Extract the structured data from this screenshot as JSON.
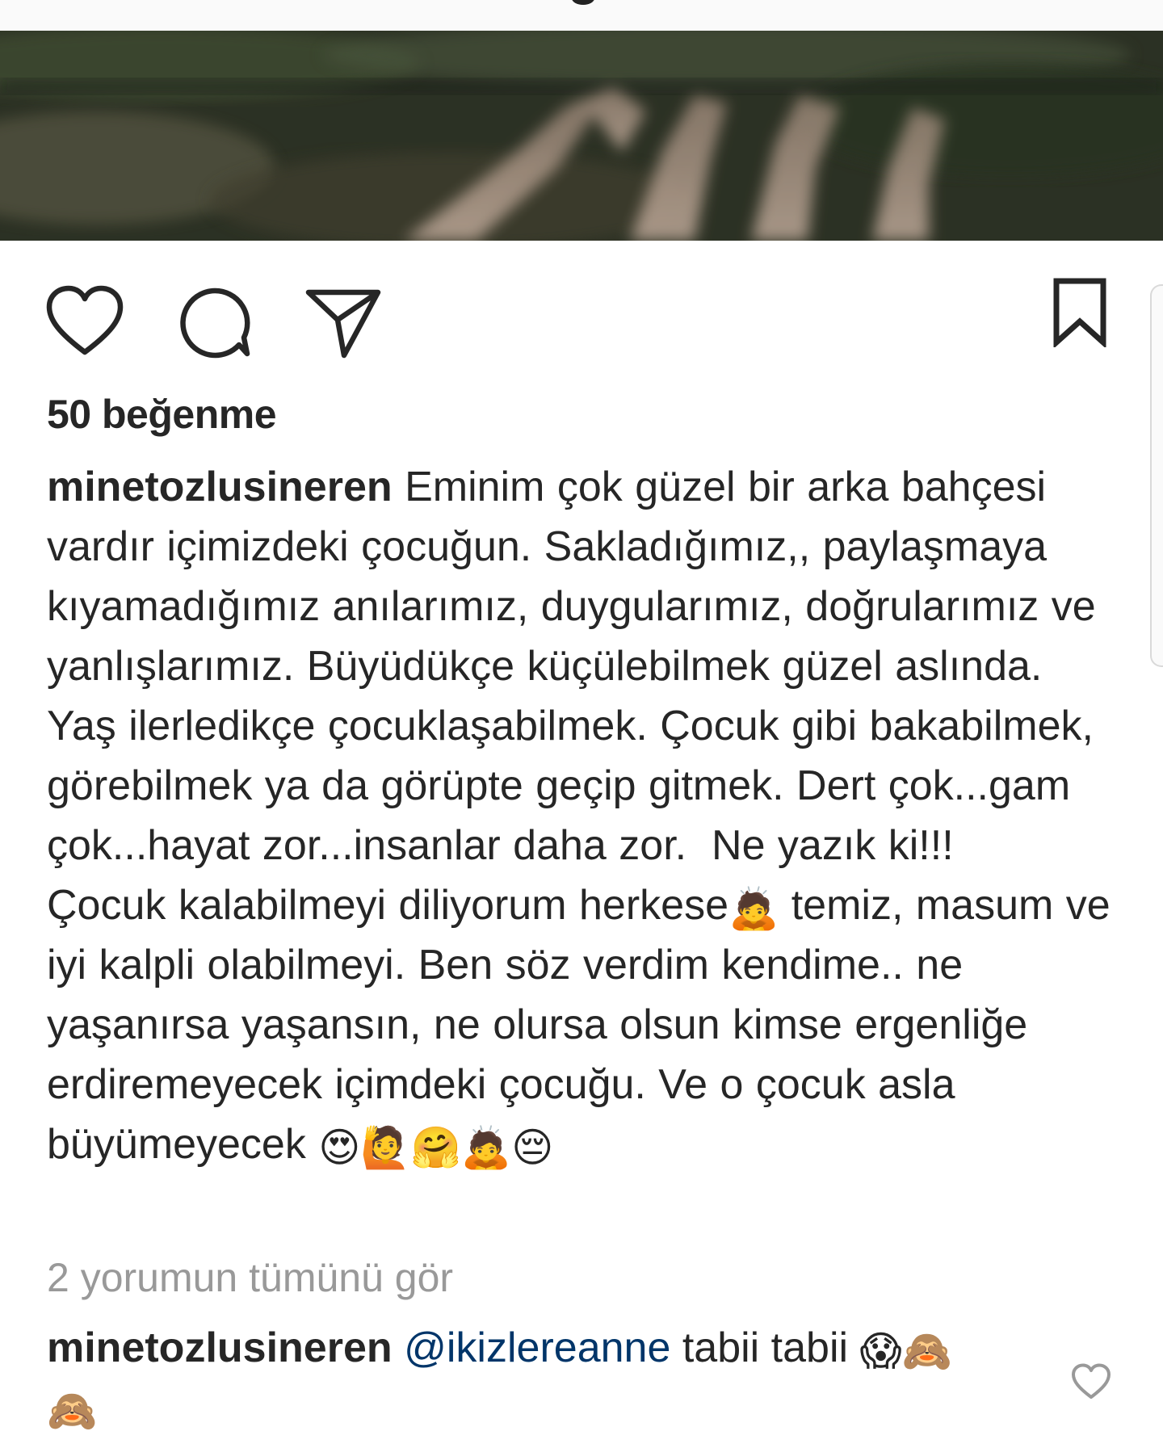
{
  "post": {
    "likes_text": "50 beğenme",
    "caption_user": "minetozlusineren",
    "caption_body": " Eminim çok güzel bir arka bahçesi vardır içimizdeki çocuğun. Sakladığımız,, paylaşmaya kıyamadığımız anılarımız, duygularımız, doğrularımız ve yanlışlarımız. Büyüdükçe küçülebilmek güzel aslında. Yaş ilerledikçe çocuklaşabilmek. Çocuk gibi bakabilmek, görebilmek ya da görüpte geçip gitmek. Dert çok...gam çok...hayat zor...insanlar daha zor.  Ne yazık ki!!!\nÇocuk kalabilmeyi diliyorum herkese",
    "caption_emoji_1": "🙇",
    "caption_body_2": " temiz, masum ve iyi kalpli olabilmeyi. Ben söz verdim kendime.. ne yaşanırsa yaşansın, ne olursa olsun kimse ergenliğe erdiremeyecek içimdeki çocuğu. Ve o çocuk asla büyümeyecek ",
    "caption_emojis_end": "😍🙋🤗🙇😔",
    "view_comments_text": "2 yorumun tümünü gör"
  },
  "comment": {
    "user": "minetozlusineren",
    "mention": "@ikizlereanne",
    "text": " tabii tabii ",
    "emojis": "😱🙈",
    "emoji_line2": "🙈"
  },
  "icons": {
    "like": "heart-icon",
    "comment": "comment-bubble-icon",
    "share": "paper-plane-icon",
    "save": "bookmark-icon",
    "comment_like": "heart-icon"
  },
  "colors": {
    "text": "#262626",
    "muted": "#999999",
    "mention": "#003569"
  }
}
